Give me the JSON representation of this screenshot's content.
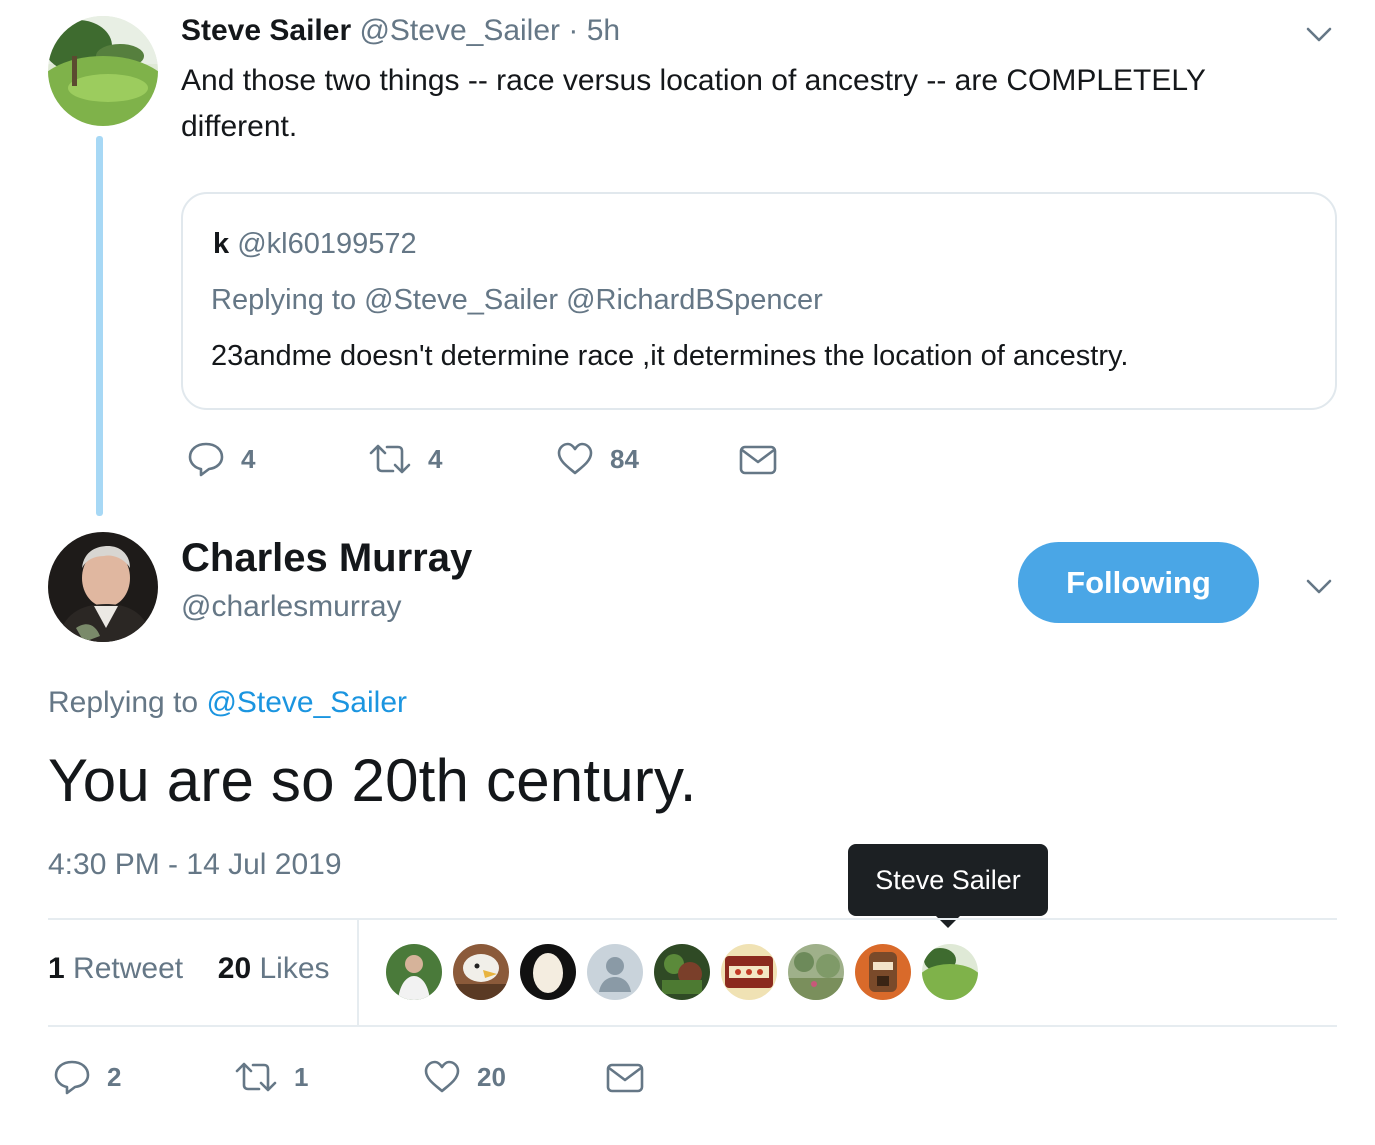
{
  "parent_tweet": {
    "name": "Steve Sailer",
    "handle": "@Steve_Sailer",
    "separator": "·",
    "time": "5h",
    "text": "And those two things -- race versus location of ancestry -- are COMPLETELY different.",
    "quoted": {
      "name": "k",
      "handle": "@kl60199572",
      "replying_to": "Replying to @Steve_Sailer @RichardBSpencer",
      "text": "23andme doesn't determine race ,it determines the location of ancestry."
    },
    "actions": {
      "replies": "4",
      "retweets": "4",
      "likes": "84"
    }
  },
  "main_tweet": {
    "name": "Charles Murray",
    "handle": "@charlesmurray",
    "follow_label": "Following",
    "replying_prefix": "Replying to",
    "replying_handle": "@Steve_Sailer",
    "text": "You are so 20th century.",
    "timestamp": "4:30 PM - 14 Jul 2019",
    "stats": {
      "retweet_count": "1",
      "retweet_label": "Retweet",
      "like_count": "20",
      "like_label": "Likes"
    },
    "tooltip": "Steve Sailer",
    "actions": {
      "replies": "2",
      "retweets": "1",
      "likes": "20"
    }
  },
  "colors": {
    "accent": "#1b95e0",
    "follow_button": "#4aa6e6",
    "thread_line": "#a7d8f5",
    "secondary_text": "#657786"
  }
}
